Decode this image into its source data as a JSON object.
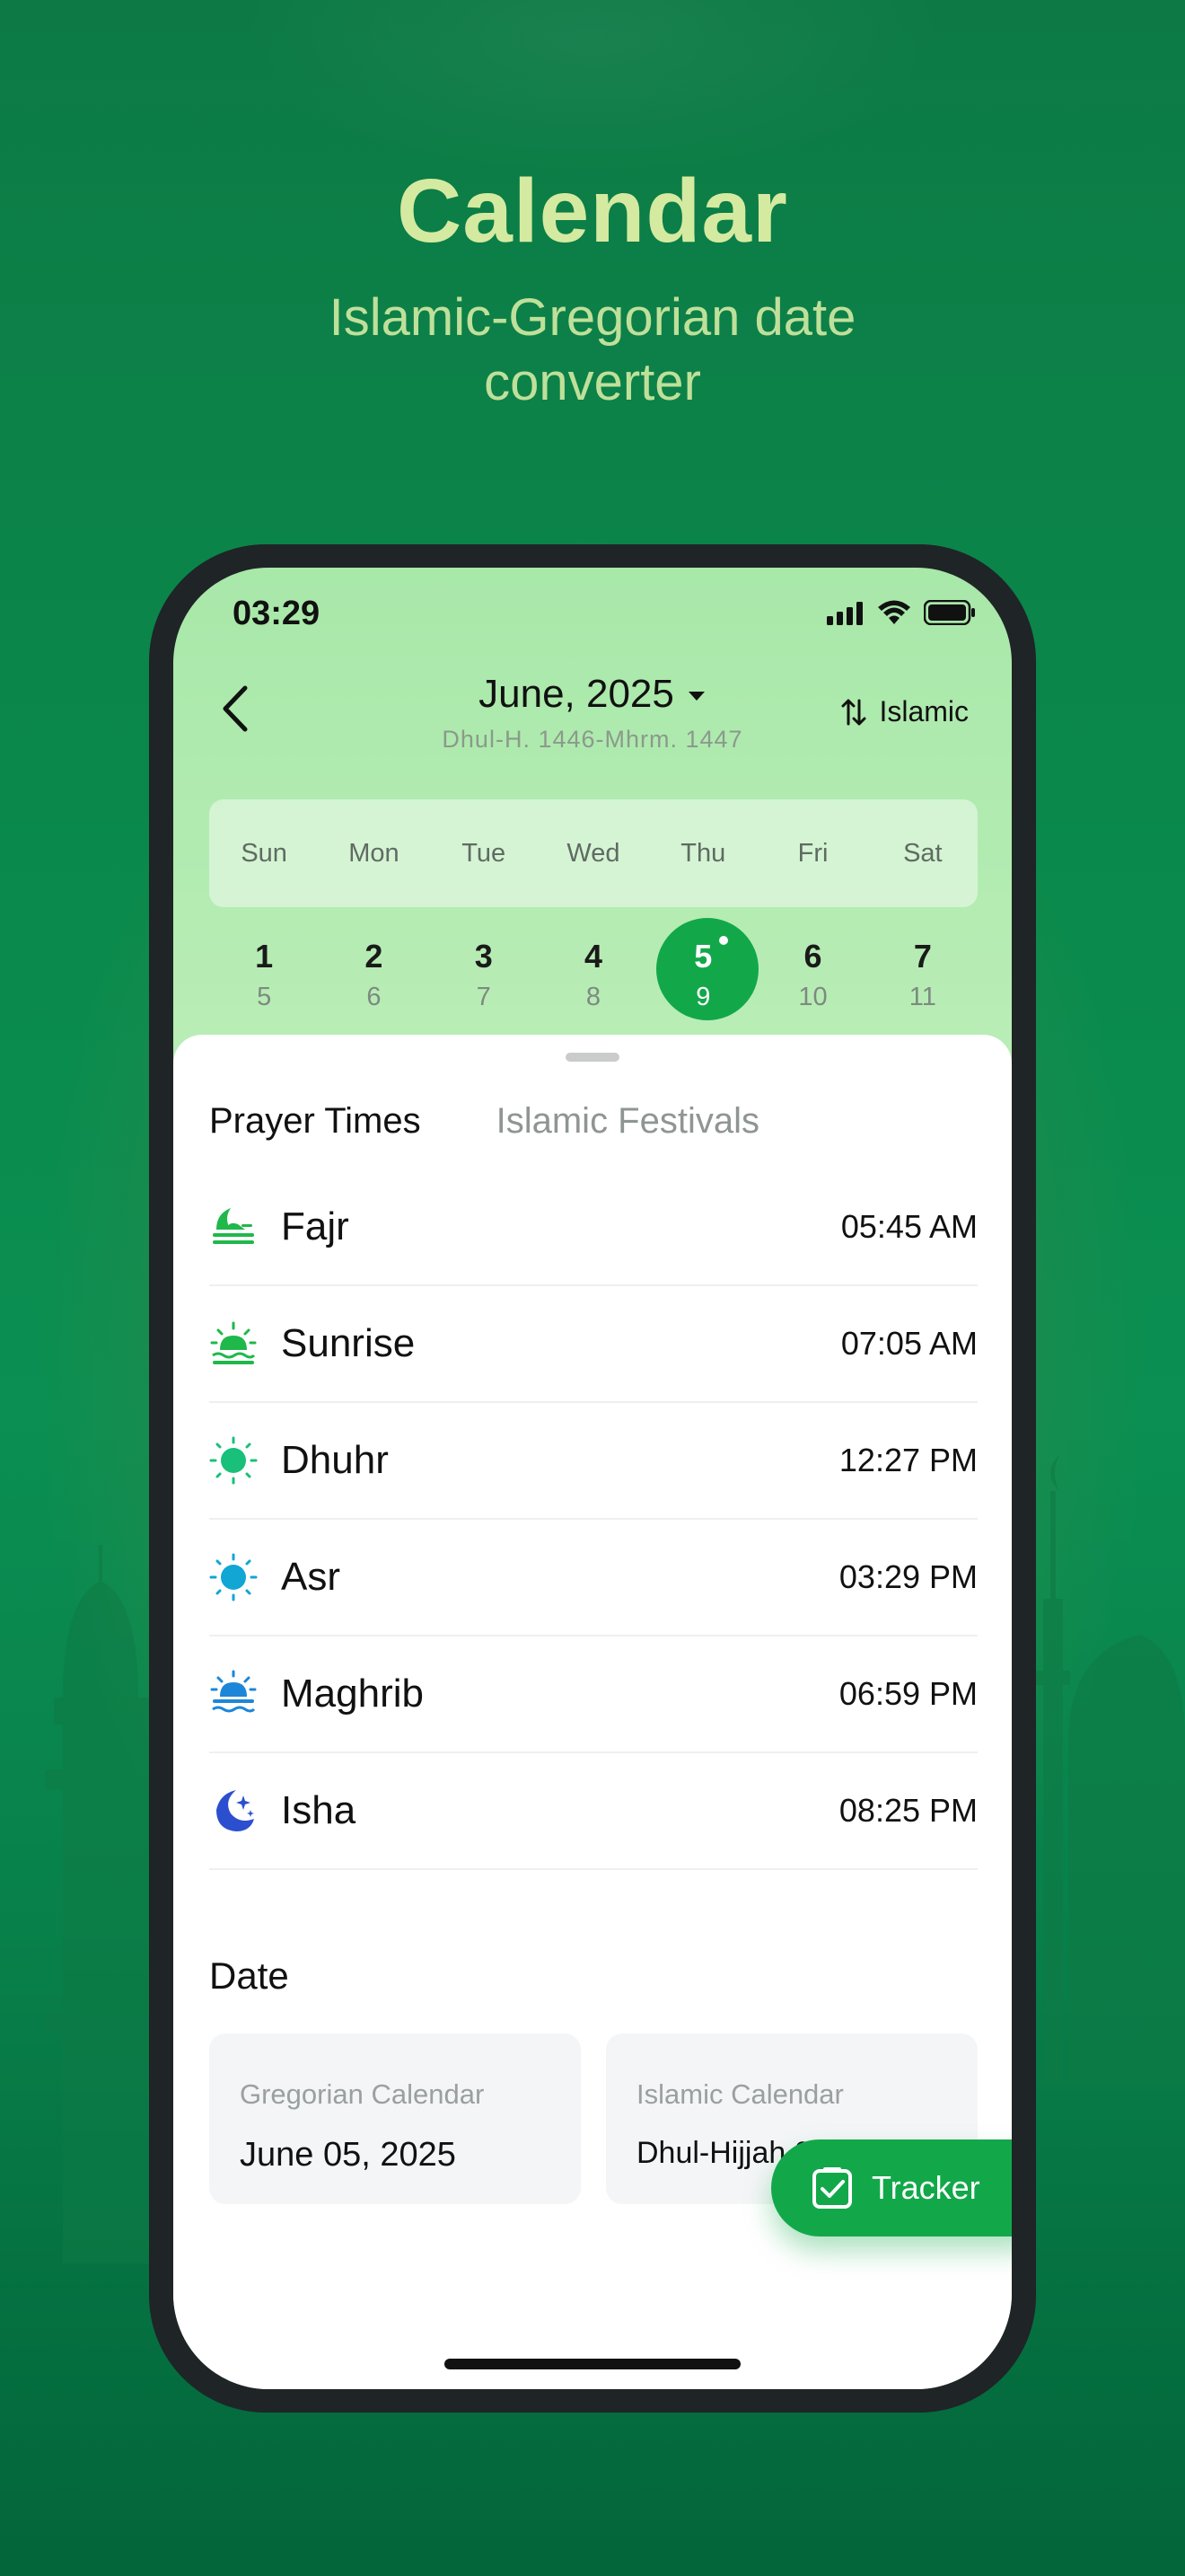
{
  "hero": {
    "title": "Calendar",
    "subtitle": "Islamic-Gregorian date converter"
  },
  "status_bar": {
    "time": "03:29"
  },
  "header": {
    "month": "June, 2025",
    "hijri_range": "Dhul-H. 1446-Mhrm. 1447",
    "calendar_toggle": "Islamic"
  },
  "weekdays": [
    "Sun",
    "Mon",
    "Tue",
    "Wed",
    "Thu",
    "Fri",
    "Sat"
  ],
  "days": [
    {
      "g": "1",
      "h": "5"
    },
    {
      "g": "2",
      "h": "6"
    },
    {
      "g": "3",
      "h": "7"
    },
    {
      "g": "4",
      "h": "8"
    },
    {
      "g": "5",
      "h": "9"
    },
    {
      "g": "6",
      "h": "10"
    },
    {
      "g": "7",
      "h": "11"
    }
  ],
  "tabs": {
    "active": "Prayer Times",
    "inactive": "Islamic Festivals"
  },
  "prayers": [
    {
      "name": "Fajr",
      "time": "05:45 AM",
      "icon": "fajr-icon",
      "color": "#1fb84a"
    },
    {
      "name": "Sunrise",
      "time": "07:05 AM",
      "icon": "sunrise-icon",
      "color": "#1fb84a"
    },
    {
      "name": "Dhuhr",
      "time": "12:27 PM",
      "icon": "sun-icon",
      "color": "#18c07a"
    },
    {
      "name": "Asr",
      "time": "03:29 PM",
      "icon": "sun-icon",
      "color": "#12a6d4"
    },
    {
      "name": "Maghrib",
      "time": "06:59 PM",
      "icon": "sunset-icon",
      "color": "#1d86d8"
    },
    {
      "name": "Isha",
      "time": "08:25 PM",
      "icon": "moon-stars-icon",
      "color": "#2c4fd0"
    }
  ],
  "date_section": {
    "heading": "Date",
    "gregorian_label": "Gregorian Calendar",
    "gregorian_value": "June 05, 2025",
    "islamic_label": "Islamic Calendar",
    "islamic_value": "Dhul-Hijjah 09, 1446"
  },
  "tracker": {
    "label": "Tracker"
  },
  "colors": {
    "accent": "#12a84a",
    "hero_title": "#d4eaa0"
  }
}
